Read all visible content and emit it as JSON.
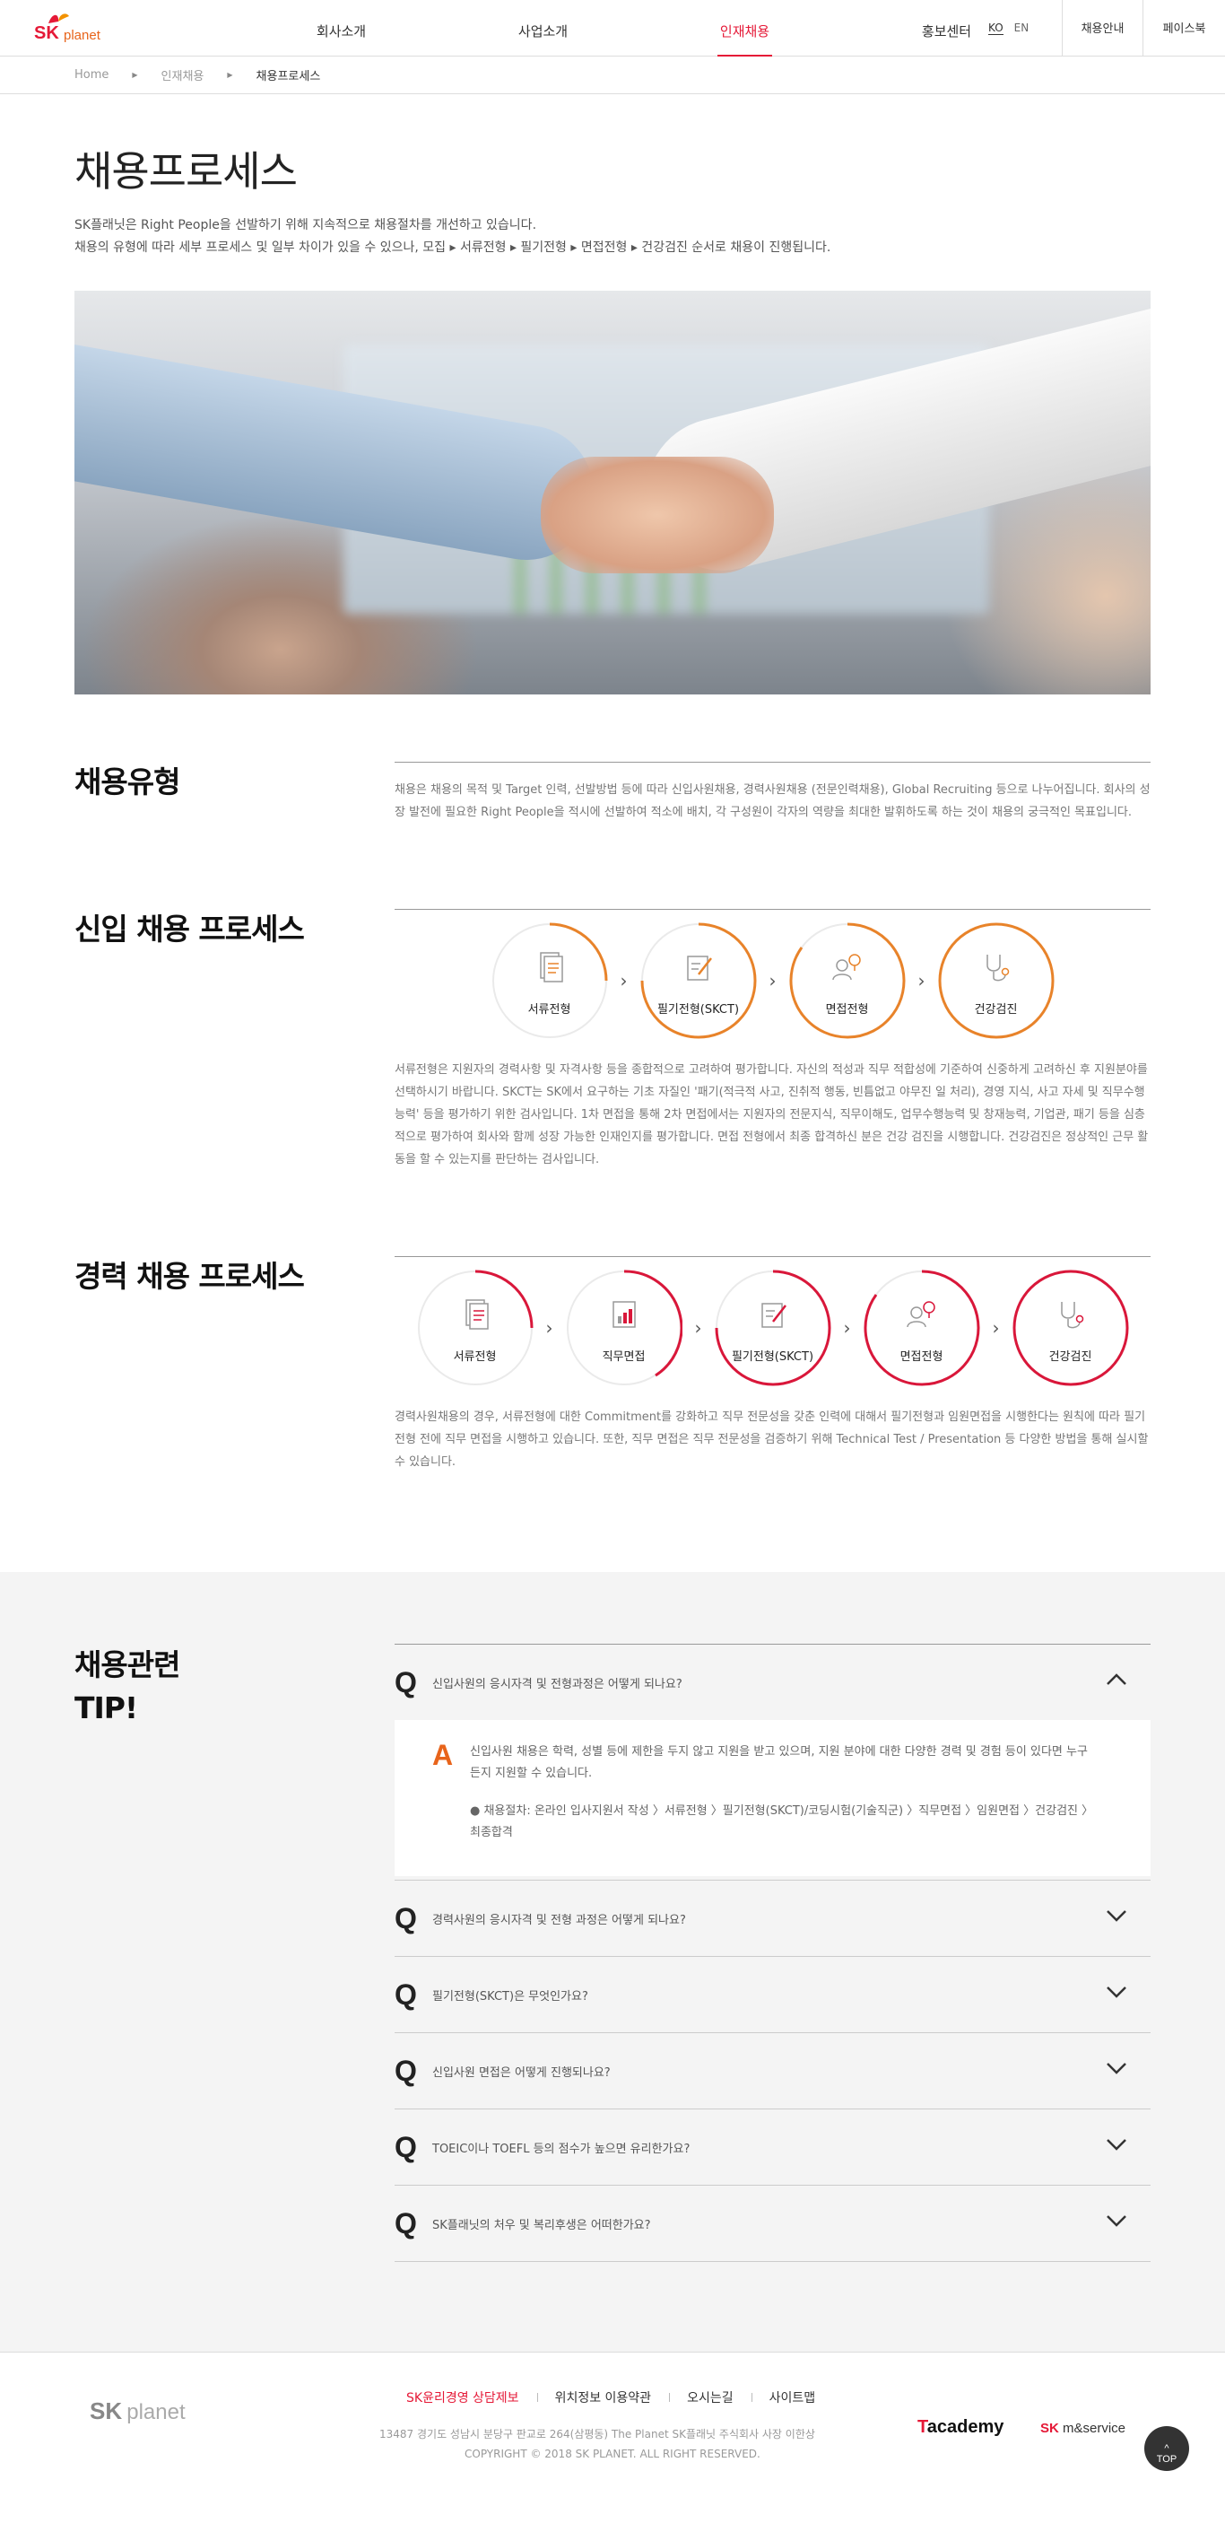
{
  "header": {
    "logo_sk": "SK",
    "logo_planet": "planet",
    "nav": [
      "회사소개",
      "사업소개",
      "인재채용",
      "홍보센터"
    ],
    "lang": [
      "KO",
      "EN"
    ],
    "util": [
      "채용안내",
      "페이스북"
    ]
  },
  "breadcrumb": [
    "Home",
    "인재채용",
    "채용프로세스"
  ],
  "page": {
    "title": "채용프로세스",
    "intro_1": "SK플래닛은 Right People을 선발하기 위해 지속적으로 채용절차를 개선하고 있습니다.",
    "intro_2": "채용의 유형에 따라 세부 프로세스 및 일부 차이가 있을 수 있으나, 모집 ▸ 서류전형 ▸ 필기전형 ▸ 면접전형 ▸ 건강검진 순서로 채용이 진행됩니다."
  },
  "types": {
    "title": "채용유형",
    "text": "채용은 채용의 목적 및 Target 인력, 선발방법 등에 따라 신입사원채용, 경력사원채용 (전문인력채용), Global Recruiting 등으로 나누어집니다. 회사의 성장 발전에 필요한 Right People을 적시에 선발하여 적소에 배치, 각 구성원이 각자의 역량을 최대한 발휘하도록 하는 것이 채용의 궁극적인 목표입니다."
  },
  "newhire": {
    "title": "신입 채용 프로세스",
    "color": "#e8832a",
    "steps": [
      "서류전형",
      "필기전형(SKCT)",
      "면접전형",
      "건강검진"
    ],
    "text": "서류전형은 지원자의 경력사항 및 자격사항 등을 종합적으로 고려하여 평가합니다. 자신의 적성과 직무 적합성에 기준하여 신중하게 고려하신 후 지원분야를 선택하시기 바랍니다. SKCT는 SK에서 요구하는 기초 자질인 '패기(적극적 사고, 진취적 행동, 빈틈없고 야무진 일 처리), 경영 지식, 사고 자세 및 직무수행 능력' 등을 평가하기 위한 검사입니다. 1차 면접을 통해 2차 면접에서는 지원자의 전문지식, 직무이해도, 업무수행능력 및 창재능력, 기업관, 패기 등을 심층적으로 평가하여 회사와 함께 성장 가능한 인재인지를 평가합니다. 면접 전형에서 최종 합격하신 분은 건강 검진을 시행합니다. 건강검진은 정상적인 근무 활동을 할 수 있는지를 판단하는 검사입니다."
  },
  "career": {
    "title": "경력 채용 프로세스",
    "color": "#d9173a",
    "steps": [
      "서류전형",
      "직무면접",
      "필기전형(SKCT)",
      "면접전형",
      "건강검진"
    ],
    "text": "경력사원채용의 경우, 서류전형에 대한 Commitment를 강화하고 직무 전문성을 갖춘 인력에 대해서 필기전형과 임원면접을 시행한다는 원칙에 따라 필기전형 전에 직무 면접을 시행하고 있습니다. 또한, 직무 면접은 직무 전문성을 검증하기 위해 Technical Test / Presentation 등 다양한 방법을 통해 실시할 수 있습니다."
  },
  "tips": {
    "title_1": "채용관련",
    "title_2": "TIP!",
    "q_mark": "Q",
    "a_mark": "A",
    "items": [
      {
        "q": "신입사원의 응시자격 및 전형과정은 어떻게 되나요?",
        "open": true,
        "a1": "신입사원 채용은 학력, 성별 등에 제한을 두지 않고 지원을 받고 있으며, 지원 분야에 대한 다양한 경력 및 경험 등이 있다면 누구든지 지원할 수 있습니다.",
        "a2": "● 채용절차: 온라인 입사지원서 작성 〉서류전형 〉필기전형(SKCT)/코딩시험(기술직군) 〉직무면접 〉임원면접 〉건강검진 〉최종합격"
      },
      {
        "q": "경력사원의 응시자격 및 전형 과정은 어떻게 되나요?",
        "open": false
      },
      {
        "q": "필기전형(SKCT)은 무엇인가요?",
        "open": false
      },
      {
        "q": "신입사원 면접은 어떻게 진행되나요?",
        "open": false
      },
      {
        "q": "TOEIC이나 TOEFL 등의 점수가 높으면 유리한가요?",
        "open": false
      },
      {
        "q": "SK플래닛의 처우 및 복리후생은 어떠한가요?",
        "open": false
      }
    ]
  },
  "footer": {
    "logo_sk": "SK",
    "logo_planet": "planet",
    "links": [
      "SK윤리경영 상담제보",
      "위치정보 이용약관",
      "오시는길",
      "사이트맵"
    ],
    "address": "13487 경기도 성남시 분당구 판교로 264(삼평동)   The Planet SK플래닛 주식회사   사장 이한상",
    "copyright": "COPYRIGHT © 2018 SK PLANET. ALL RIGHT RESERVED.",
    "tacademy_t": "T",
    "tacademy_rest": "academy",
    "msvc_sk": "SK",
    "msvc_rest": " m&service",
    "top": "TOP"
  }
}
